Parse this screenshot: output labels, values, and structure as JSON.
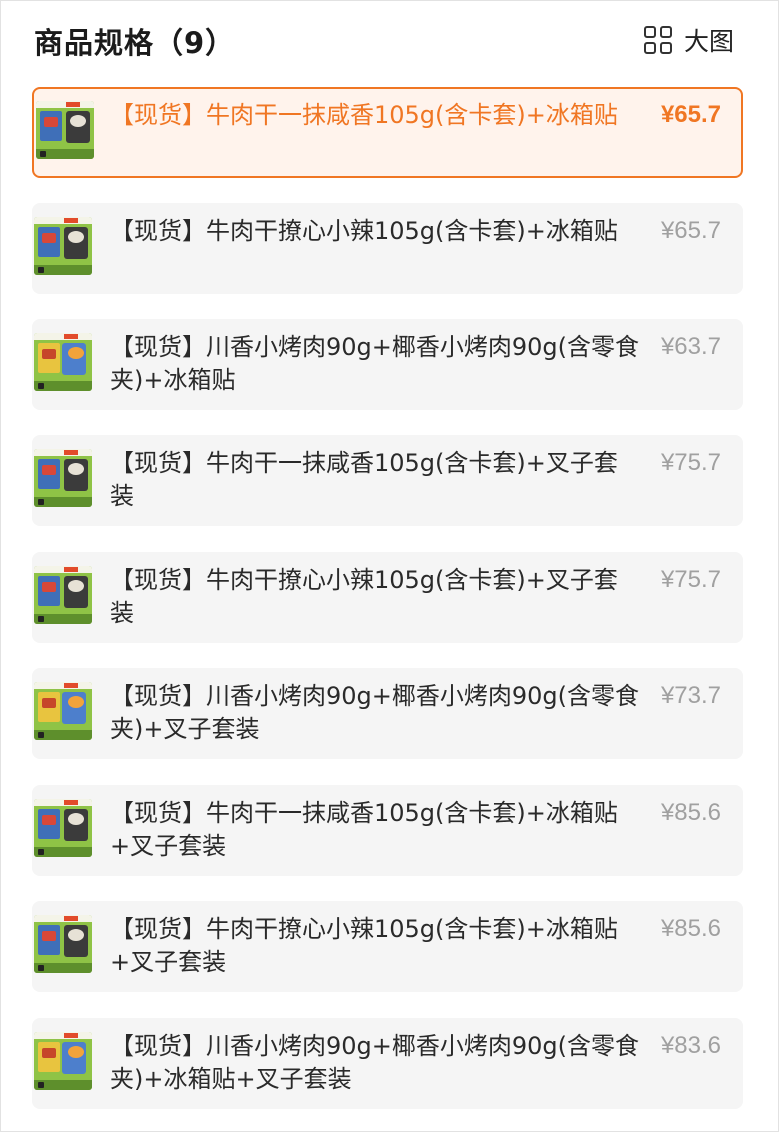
{
  "header": {
    "title": "商品规格（9）",
    "big_image_label": "大图",
    "big_image_icon": "grid-icon"
  },
  "accent_color": "#f07623",
  "skus": [
    {
      "label": "【现货】牛肉干一抹咸香105g(含卡套)+冰箱贴",
      "price": "¥65.7",
      "selected": true
    },
    {
      "label": "【现货】牛肉干撩心小辣105g(含卡套)+冰箱贴",
      "price": "¥65.7",
      "selected": false
    },
    {
      "label": "【现货】川香小烤肉90g+椰香小烤肉90g(含零食夹)+冰箱贴",
      "price": "¥63.7",
      "selected": false
    },
    {
      "label": "【现货】牛肉干一抹咸香105g(含卡套)+叉子套装",
      "price": "¥75.7",
      "selected": false
    },
    {
      "label": "【现货】牛肉干撩心小辣105g(含卡套)+叉子套装",
      "price": "¥75.7",
      "selected": false
    },
    {
      "label": "【现货】川香小烤肉90g+椰香小烤肉90g(含零食夹)+叉子套装",
      "price": "¥73.7",
      "selected": false
    },
    {
      "label": "【现货】牛肉干一抹咸香105g(含卡套)+冰箱贴+叉子套装",
      "price": "¥85.6",
      "selected": false
    },
    {
      "label": "【现货】牛肉干撩心小辣105g(含卡套)+冰箱贴+叉子套装",
      "price": "¥85.6",
      "selected": false
    },
    {
      "label": "【现货】川香小烤肉90g+椰香小烤肉90g(含零食夹)+冰箱贴+叉子套装",
      "price": "¥83.6",
      "selected": false
    }
  ]
}
